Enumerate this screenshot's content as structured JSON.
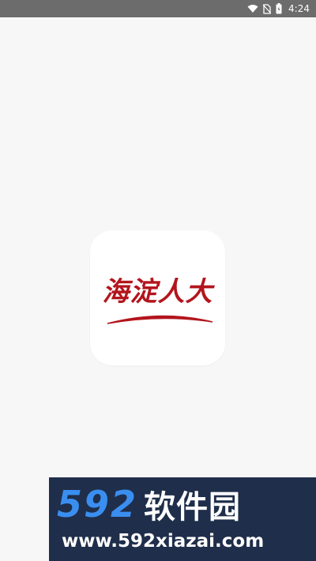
{
  "status_bar": {
    "time": "4:24",
    "icons": [
      "wifi-icon",
      "no-sim-icon",
      "battery-icon"
    ]
  },
  "splash": {
    "logo_text": "海淀人大",
    "logo_color": "#b3151d"
  },
  "watermark": {
    "number": "592",
    "name": "软件园",
    "url": "www.592xiazai.com"
  }
}
